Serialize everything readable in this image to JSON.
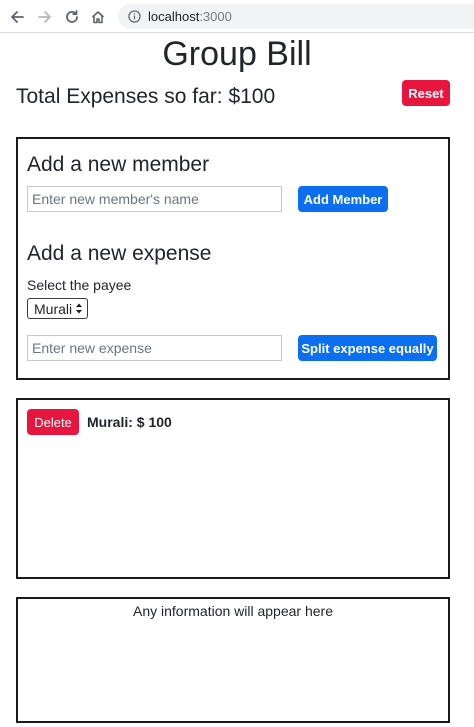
{
  "browser": {
    "url_host": "localhost",
    "url_port": ":3000"
  },
  "page": {
    "title": "Group Bill",
    "total_label": "Total Expenses so far: $100",
    "reset_label": "Reset"
  },
  "add_member": {
    "heading": "Add a new member",
    "input_placeholder": "Enter new member's name",
    "button_label": "Add Member"
  },
  "add_expense": {
    "heading": "Add a new expense",
    "payee_label": "Select the payee",
    "payee_selected": "Murali",
    "input_placeholder": "Enter new expense",
    "button_label": "Split expense equally"
  },
  "expenses": [
    {
      "delete_label": "Delete",
      "text": "Murali: $ 100"
    }
  ],
  "info": {
    "message": "Any information will appear here"
  },
  "colors": {
    "danger": "#e8153f",
    "primary": "#0b6ff0",
    "border": "#1b1b1b"
  }
}
